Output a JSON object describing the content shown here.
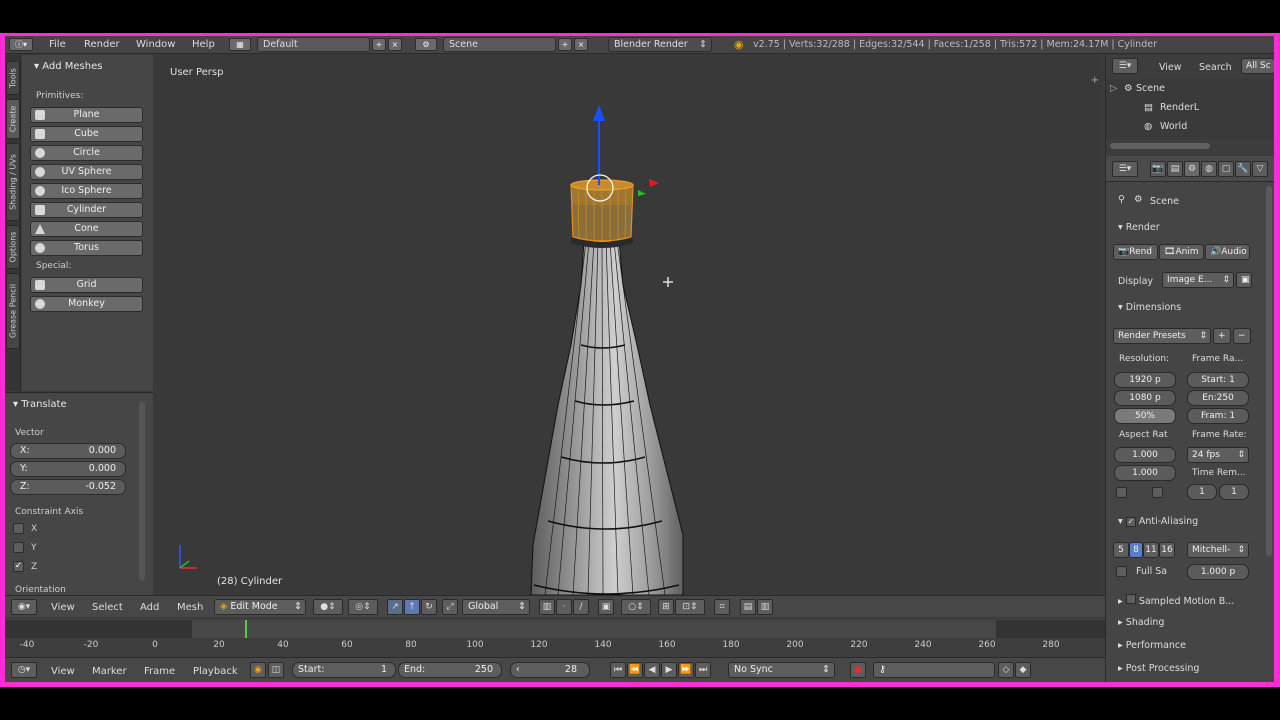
{
  "topbar": {
    "menus": [
      "File",
      "Render",
      "Window",
      "Help"
    ],
    "layout_value": "Default",
    "scene_value": "Scene",
    "engine_value": "Blender Render",
    "stats": "v2.75 | Verts:32/288 | Edges:32/544 | Faces:1/258 | Tris:572 | Mem:24.17M | Cylinder"
  },
  "tabs": [
    "Tools",
    "Create",
    "Shading / UVs",
    "Options",
    "Grease Pencil"
  ],
  "add_meshes": {
    "title": "Add Meshes",
    "primitives_label": "Primitives:",
    "primitives": [
      "Plane",
      "Cube",
      "Circle",
      "UV Sphere",
      "Ico Sphere",
      "Cylinder",
      "Cone",
      "Torus"
    ],
    "special_label": "Special:",
    "special": [
      "Grid",
      "Monkey"
    ]
  },
  "translate": {
    "title": "Translate",
    "vector_label": "Vector",
    "x_label": "X:",
    "x": "0.000",
    "y_label": "Y:",
    "y": "0.000",
    "z_label": "Z:",
    "z": "-0.052",
    "constraint_label": "Constraint Axis",
    "axes": [
      "X",
      "Y",
      "Z"
    ],
    "axes_checked": [
      false,
      false,
      true
    ],
    "orientation_label": "Orientation"
  },
  "viewport": {
    "view_name": "User Persp",
    "object_info": "(28) Cylinder"
  },
  "view3d_header": {
    "menus": [
      "View",
      "Select",
      "Add",
      "Mesh"
    ],
    "mode": "Edit Mode",
    "orientation": "Global"
  },
  "timeline": {
    "ticks": [
      "-40",
      "-20",
      "0",
      "20",
      "40",
      "60",
      "80",
      "100",
      "120",
      "140",
      "160",
      "180",
      "200",
      "220",
      "240",
      "260",
      "280"
    ],
    "current_frame_marker": 28,
    "menus": [
      "View",
      "Marker",
      "Frame",
      "Playback"
    ],
    "start_label": "Start:",
    "start": "1",
    "end_label": "End:",
    "end": "250",
    "current": "28",
    "sync": "No Sync"
  },
  "outliner": {
    "menus": [
      "View",
      "Search"
    ],
    "filter": "All Sc",
    "items": [
      "Scene",
      "RenderL",
      "World"
    ]
  },
  "properties": {
    "context": "Scene",
    "render_title": "Render",
    "render_buttons": [
      "Rend",
      "Anim",
      "Audio"
    ],
    "display_label": "Display",
    "display_value": "Image E...",
    "dimensions_title": "Dimensions",
    "render_presets": "Render Presets",
    "resolution_label": "Resolution:",
    "frame_range_label": "Frame Ra...",
    "res_x": "1920 p",
    "res_y": "1080 p",
    "res_pct": "50%",
    "frame_start": "Start: 1",
    "frame_end": "En:250",
    "frame_step": "Fram: 1",
    "aspect_label": "Aspect Rat",
    "frame_rate_label": "Frame Rate:",
    "aspect_x": "1.000",
    "aspect_y": "1.000",
    "fps": "24 fps",
    "time_remap_label": "Time Rem...",
    "time_old": "1",
    "time_new": "1",
    "aa_title": "Anti-Aliasing",
    "aa_samples": [
      "5",
      "8",
      "11",
      "16"
    ],
    "aa_selected": "8",
    "aa_filter": "Mitchell-",
    "full_sample": "Full Sa",
    "filter_size": "1.000 p",
    "sampled_motion": "Sampled Motion B...",
    "shading": "Shading",
    "performance": "Performance",
    "post_processing": "Post Processing"
  },
  "colors": {
    "frame_border": "#ff2bd6",
    "selection": "#e8901c",
    "current_frame": "#4ad14a",
    "axis_z": "#1a4fff",
    "axis_x": "#e41b1b",
    "axis_y": "#22c022"
  }
}
